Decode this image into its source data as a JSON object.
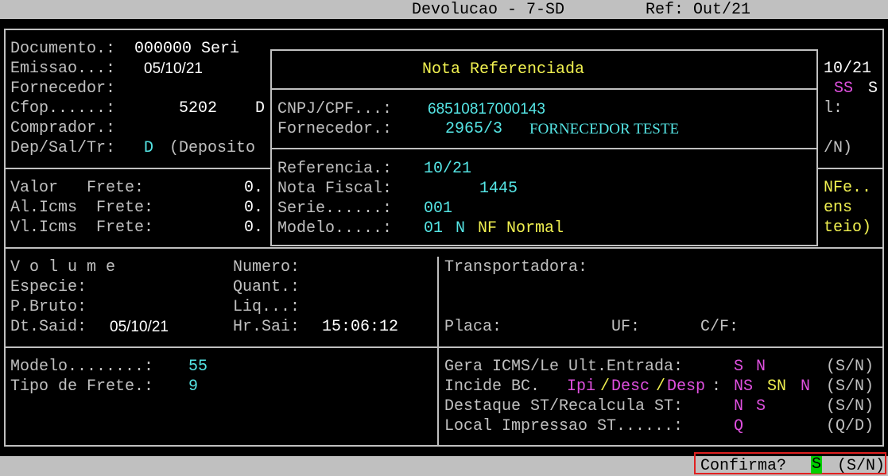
{
  "header": {
    "title": "Devolucao - 7-SD",
    "ref": "Ref: Out/21"
  },
  "doc": {
    "documento_label": "Documento.:",
    "documento_value": "000000 Seri",
    "emissao_label": "Emissao...:",
    "emissao_value": "05/10/21",
    "fornecedor_label": "Fornecedor:",
    "cfop_label": "Cfop......:",
    "cfop_value": "5202",
    "cfop_extra": "D",
    "comprador_label": "Comprador.:",
    "dep_label": "Dep/Sal/Tr:",
    "dep_value": "D",
    "dep_text": "(Deposito"
  },
  "right_partial": {
    "r1": "10/21",
    "r2a": "SS",
    "r2b": "S",
    "r3": "l:",
    "r4": "/N)",
    "r5": "NFe..",
    "r6": "ens",
    "r7": "teio)"
  },
  "frete": {
    "valor_label": "Valor   Frete:",
    "valor_value": "0.",
    "alicms_label": "Al.Icms  Frete:",
    "alicms_value": "0.",
    "vlicms_label": "Vl.Icms  Frete:",
    "vlicms_value": "0."
  },
  "popup": {
    "title": "Nota Referenciada",
    "cnpj_label": "CNPJ/CPF...:",
    "cnpj_value": "68510817000143",
    "fornecedor_label": "Fornecedor.:",
    "fornecedor_code": "2965/3",
    "fornecedor_name": "FORNECEDOR TESTE",
    "referencia_label": "Referencia.:",
    "referencia_value": "10/21",
    "nota_label": "Nota Fiscal:",
    "nota_value": "1445",
    "serie_label": "Serie......:",
    "serie_value": "001",
    "modelo_label": "Modelo.....:",
    "modelo_value": "01",
    "modelo_n": "N",
    "modelo_desc": "NF Normal"
  },
  "volume": {
    "volume_label": "V o l u m e",
    "numero_label": "Numero:",
    "especie_label": "Especie:",
    "quant_label": "Quant.:",
    "pbruto_label": "P.Bruto:",
    "liq_label": "Liq...:",
    "dtsaid_label": "Dt.Said:",
    "dtsaid_value": "05/10/21",
    "hrsai_label": "Hr.Sai:",
    "hrsai_value": "15:06:12"
  },
  "transporte": {
    "transportadora_label": "Transportadora:",
    "placa_label": "Placa:",
    "uf_label": "UF:",
    "cf_label": "C/F:"
  },
  "lower_left": {
    "modelo_label": "Modelo........:",
    "modelo_value": "55",
    "tipo_frete_label": "Tipo de Frete.:",
    "tipo_frete_value": "9"
  },
  "lower_right": {
    "gera_label": "Gera ICMS/Le Ult.Entrada:",
    "gera_v1": "S",
    "gera_v2": "N",
    "gera_opts": "(S/N)",
    "incide_label": "Incide BC.",
    "incide_ipi": "Ipi",
    "incide_slash1": "/",
    "incide_desc": "Desc",
    "incide_slash2": "/",
    "incide_desp": "Desp",
    "incide_colon": ":",
    "incide_v1": "NS",
    "incide_v2": "SN",
    "incide_v3": "N",
    "incide_opts": "(S/N)",
    "destaque_label": "Destaque ST/Recalcula ST:",
    "destaque_v1": "N",
    "destaque_v2": "S",
    "destaque_opts": "(S/N)",
    "local_label": "Local Impressao ST......:",
    "local_value": "Q",
    "local_opts": "(Q/D)"
  },
  "footer": {
    "confirm_label": "Confirma?",
    "confirm_value": "S",
    "confirm_opts": "(S/N)"
  },
  "colors": {
    "background": "#000000",
    "text": "#c0c0c0",
    "cyan": "#55e5e5",
    "magenta": "#e050e0",
    "yellow": "#f0f050",
    "status_bar": "#c0c0c0",
    "highlight_green": "#00d000",
    "focus_border": "#e02020"
  }
}
